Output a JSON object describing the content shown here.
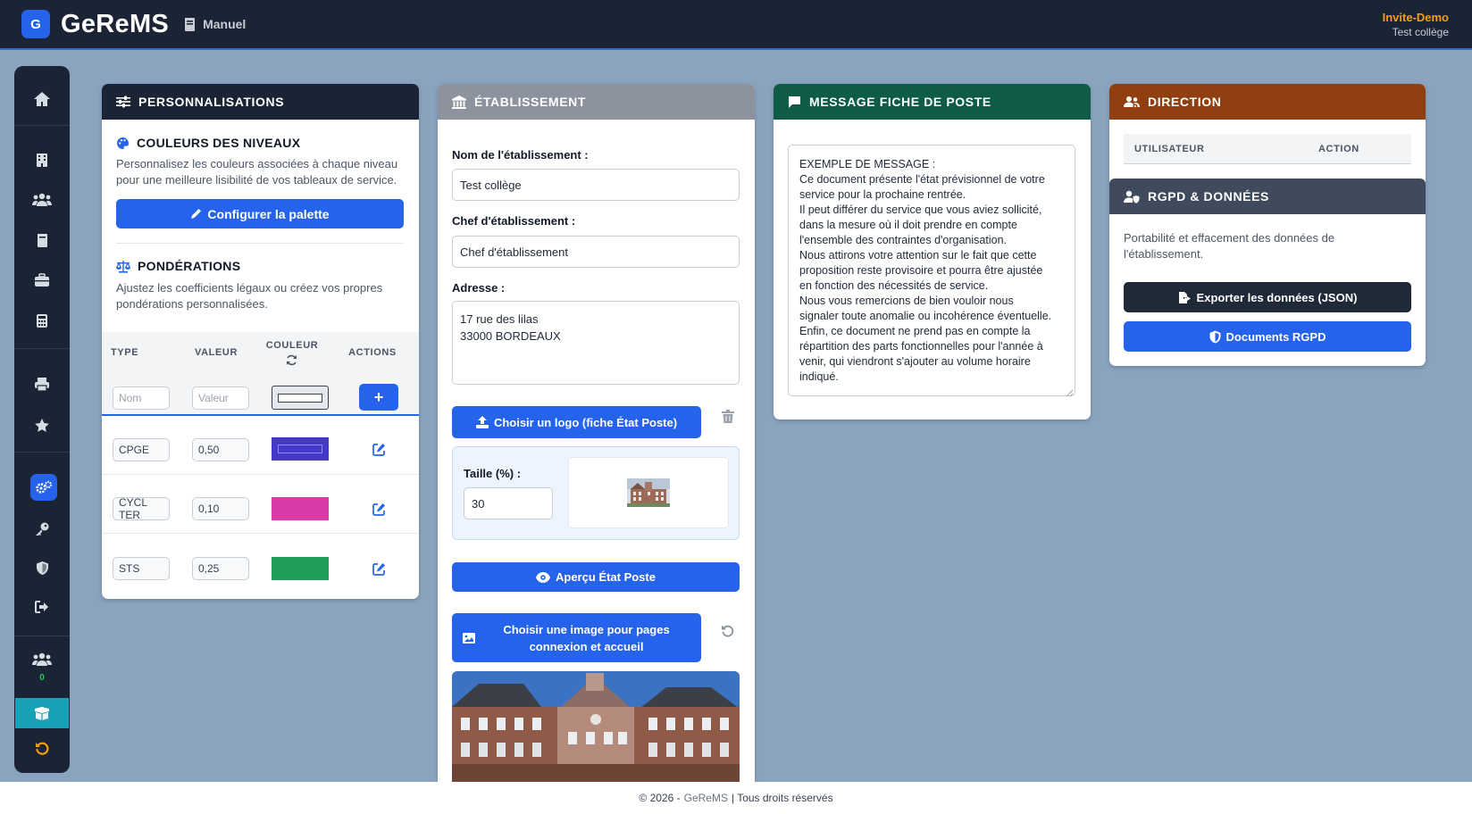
{
  "header": {
    "logo_letter": "G",
    "app_title": "GeReMS",
    "manual_label": "Manuel",
    "user_name": "Invite-Demo",
    "user_school": "Test collège"
  },
  "sidebar": {
    "online_count": "0",
    "icons": [
      "home-icon",
      "building-icon",
      "users-icon",
      "book-icon",
      "briefcase-icon",
      "calculator-icon",
      "print-icon",
      "star-icon",
      "gears-icon",
      "key-icon",
      "shield-icon",
      "logout-icon",
      "users-online-icon",
      "box-icon",
      "undo-icon"
    ]
  },
  "personnalisations": {
    "title": "PERSONNALISATIONS",
    "colors_title": "COULEURS DES NIVEAUX",
    "colors_desc": "Personnalisez les couleurs associées à chaque niveau pour une meilleure lisibilité de vos tableaux de service.",
    "palette_button": "Configurer la palette",
    "weights_title": "PONDÉRATIONS",
    "weights_desc": "Ajustez les coefficients légaux ou créez vos propres pondérations personnalisées.",
    "columns": {
      "type": "TYPE",
      "valeur": "VALEUR",
      "couleur": "COULEUR",
      "actions": "ACTIONS"
    },
    "new_row": {
      "name_placeholder": "Nom",
      "value_placeholder": "Valeur",
      "add_label": "+"
    },
    "rows": [
      {
        "type": "CPGE",
        "valeur": "0,50",
        "color": "#4338ca"
      },
      {
        "type": "CYCL TER",
        "valeur": "0,10",
        "color": "#db3ba7"
      },
      {
        "type": "STS",
        "valeur": "0,25",
        "color": "#1f9e5b"
      }
    ]
  },
  "etablissement": {
    "title": "ÉTABLISSEMENT",
    "name_label": "Nom de l'établissement :",
    "name_value": "Test collège",
    "chef_label": "Chef d'établissement :",
    "chef_value": "Chef d'établissement",
    "address_label": "Adresse :",
    "address_line1": "17 rue des lilas",
    "address_line2": "33000 BORDEAUX",
    "logo_button": "Choisir un logo (fiche État Poste)",
    "size_label": "Taille (%) :",
    "size_value": "30",
    "preview_button": "Aperçu État Poste",
    "image_button_line1": "Choisir une image pour pages",
    "image_button_line2": "connexion et accueil"
  },
  "message": {
    "title": "MESSAGE FICHE DE POSTE",
    "lines": [
      "EXEMPLE DE MESSAGE :",
      "Ce document présente l'état prévisionnel de votre",
      "service pour la prochaine rentrée.",
      "Il peut différer du service que vous aviez sollicité,",
      "dans la mesure où il doit prendre en compte",
      "l'ensemble des contraintes d'organisation.",
      "Nous attirons votre attention sur le fait que cette",
      "proposition reste provisoire et pourra être ajustée",
      "en fonction des nécessités de service.",
      "Nous vous remercions de bien vouloir nous",
      "signaler toute anomalie ou incohérence éventuelle.",
      "Enfin, ce document ne prend pas en compte la",
      "répartition des parts fonctionnelles pour l'année à",
      "venir, qui viendront s'ajouter au volume horaire",
      "indiqué."
    ]
  },
  "direction": {
    "title": "DIRECTION",
    "col_user": "UTILISATEUR",
    "col_action": "ACTION"
  },
  "rgpd": {
    "title": "RGPD & DONNÉES",
    "desc": "Portabilité et effacement des données de l'établissement.",
    "export_button": "Exporter les données (JSON)",
    "docs_button": "Documents RGPD"
  },
  "footer": {
    "copyright": "© 2026 -",
    "brand": "GeReMS",
    "rights": "| Tous droits réservés"
  },
  "colors": {
    "accent": "#2563eb",
    "navy": "#1b2434",
    "green_header": "#0e5c47",
    "brown_header": "#8f3f10",
    "user_name": "#f59e0b"
  }
}
